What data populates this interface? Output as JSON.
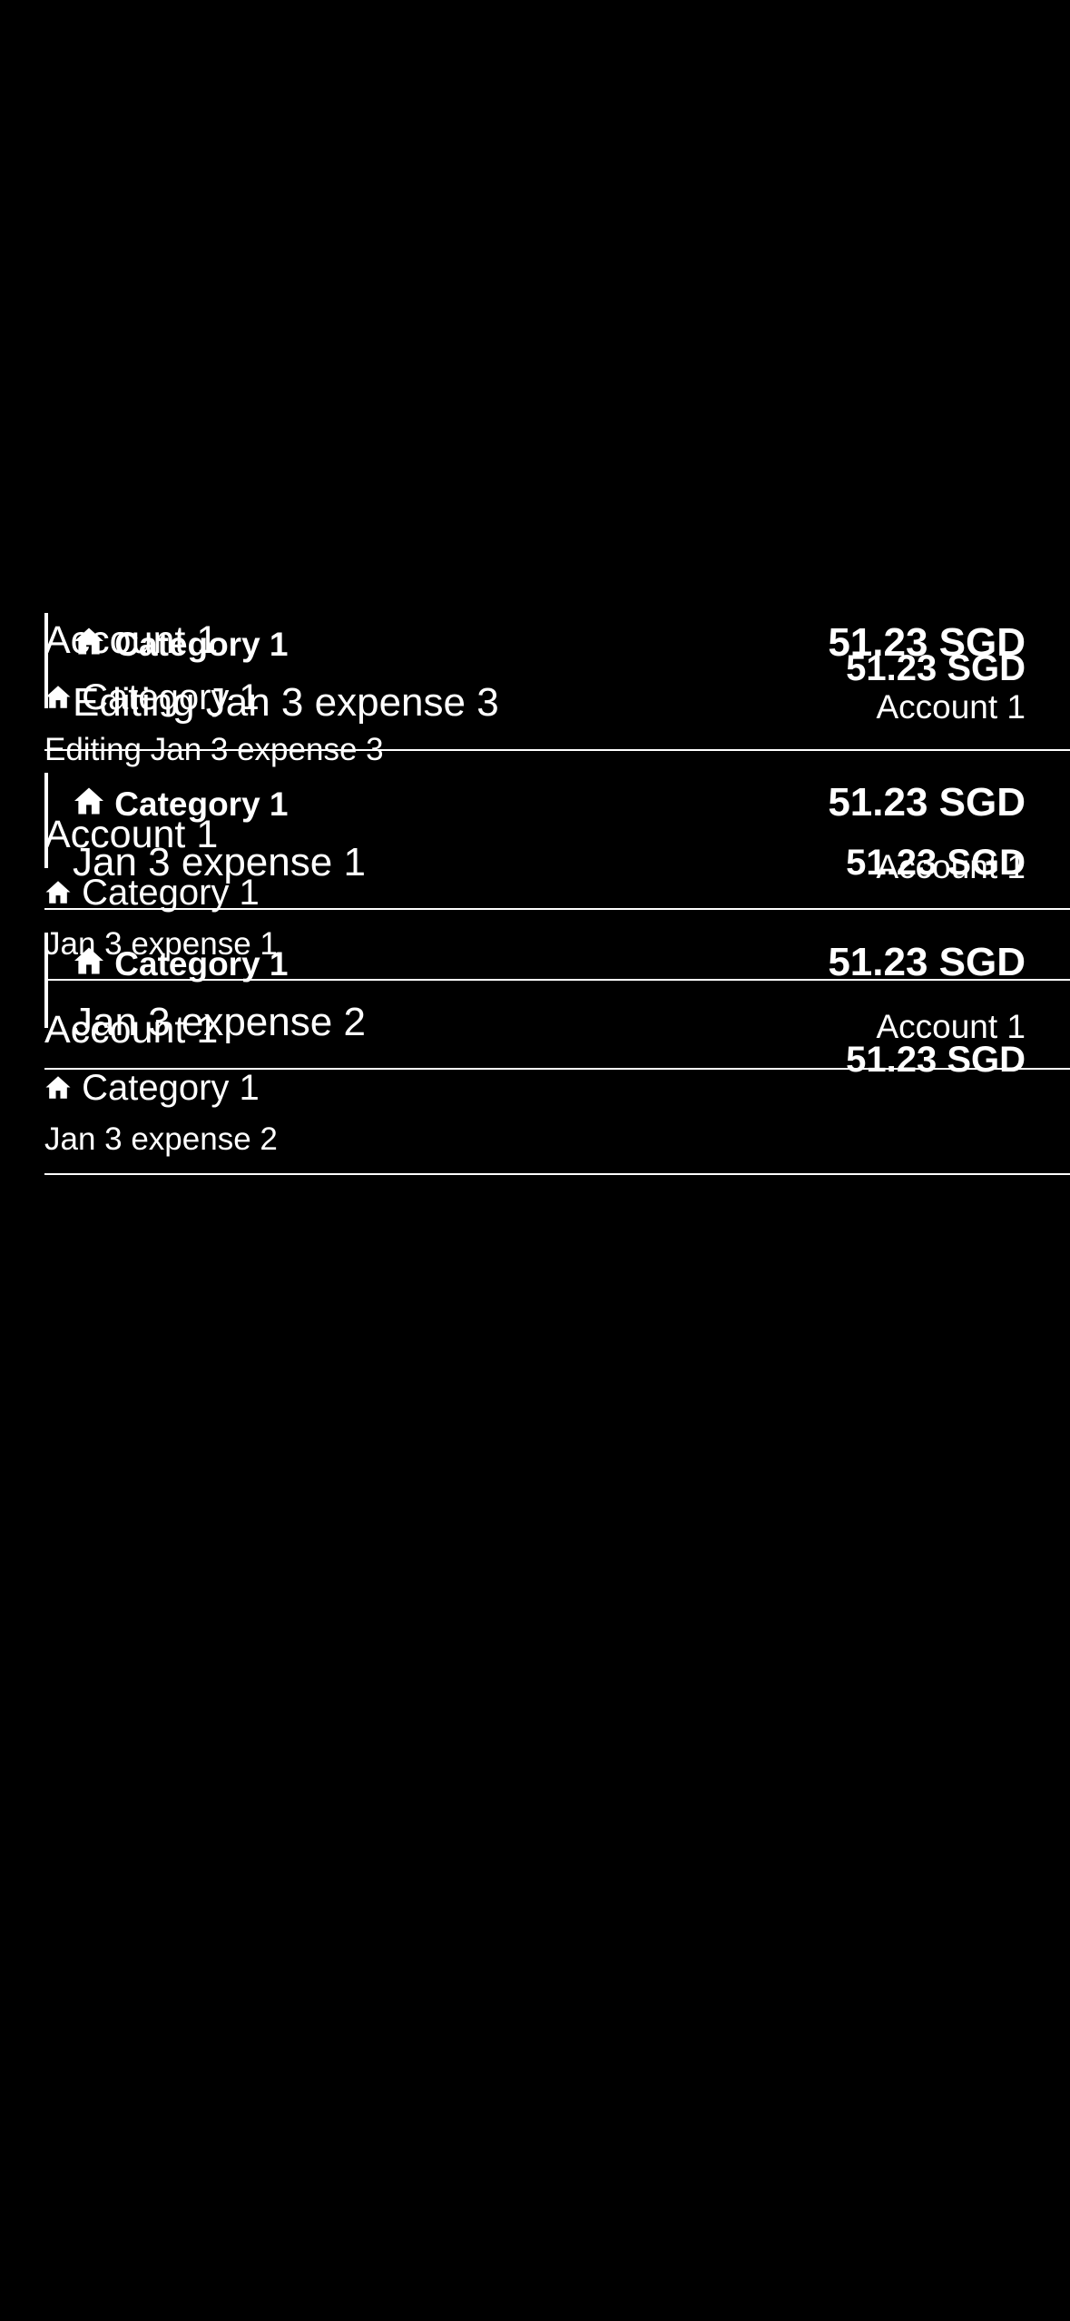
{
  "list": {
    "cards": [
      {
        "category": "Category 1",
        "title": "Editing Jan 3 expense 3",
        "amount": "51.23 SGD",
        "account": "Account 1"
      },
      {
        "category": "Category 1",
        "title": "Jan 3 expense 1",
        "amount": "51.23 SGD",
        "account": "Account 1"
      },
      {
        "category": "Category 1",
        "title": "Jan 3 expense 2",
        "amount": "51.23 SGD",
        "account": "Account 1"
      }
    ],
    "rows": [
      {
        "account": "Account 1",
        "category": "Category 1",
        "title": "Editing Jan 3 expense 3",
        "amount": "51.23 SGD"
      },
      {
        "account": "Account 1",
        "category": "Category 1",
        "title": "Jan 3 expense 1",
        "amount": "51.23 SGD"
      },
      {
        "account": "Account 1",
        "category": "Category 1",
        "title": "Jan 3 expense 2",
        "amount": "51.23 SGD"
      }
    ]
  },
  "icons": {
    "category": "home-icon"
  }
}
